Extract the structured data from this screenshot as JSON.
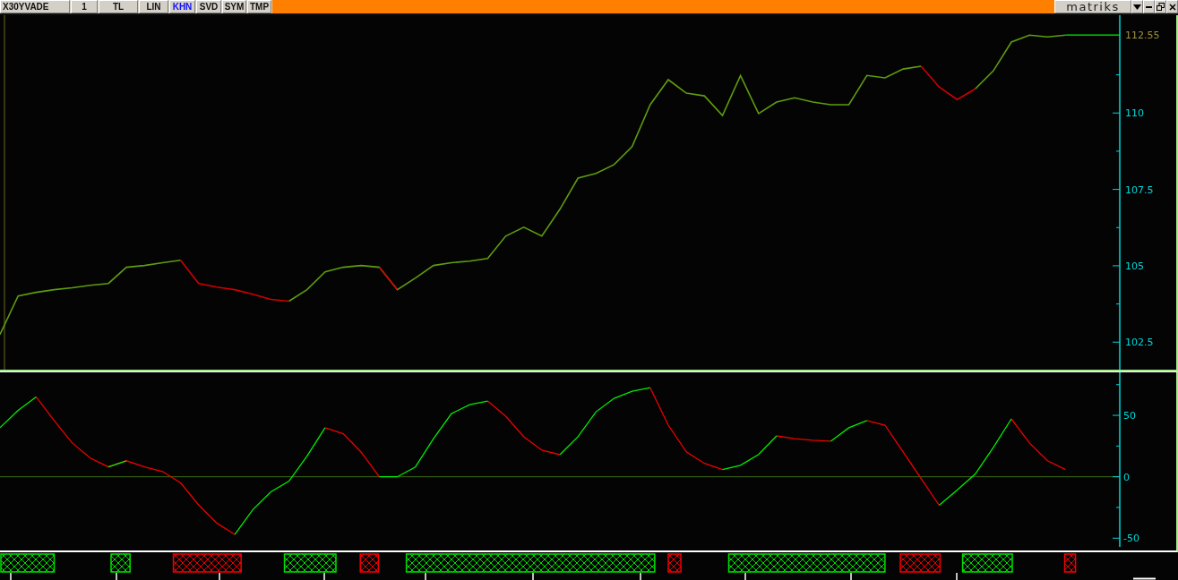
{
  "toolbar": {
    "items": [
      {
        "label": "X30YVADE",
        "selected": false
      },
      {
        "label": "1",
        "selected": false
      },
      {
        "label": "TL",
        "selected": false
      },
      {
        "label": "LIN",
        "selected": false
      },
      {
        "label": "KHN",
        "selected": true
      },
      {
        "label": "SVD",
        "selected": false
      },
      {
        "label": "SYM",
        "selected": false
      },
      {
        "label": "TMP",
        "selected": false
      }
    ],
    "logo": "matriks"
  },
  "price_panel": {
    "last_value_label": "112.55",
    "axis_labels": [
      "110",
      "107.5",
      "105",
      "102.5"
    ]
  },
  "oscillator_panel": {
    "axis_labels": [
      "50",
      "0",
      "-50"
    ]
  },
  "signal_bars": [
    {
      "color": "#00e000"
    },
    {
      "color": "#00e000"
    },
    {
      "color": "#f00000"
    },
    {
      "color": "#00e000"
    },
    {
      "color": "#f00000"
    },
    {
      "color": "#00e000"
    },
    {
      "color": "#f00000"
    },
    {
      "color": "#00e000"
    },
    {
      "color": "#f00000"
    },
    {
      "color": "#00e000"
    },
    {
      "color": "#f00000"
    }
  ]
}
